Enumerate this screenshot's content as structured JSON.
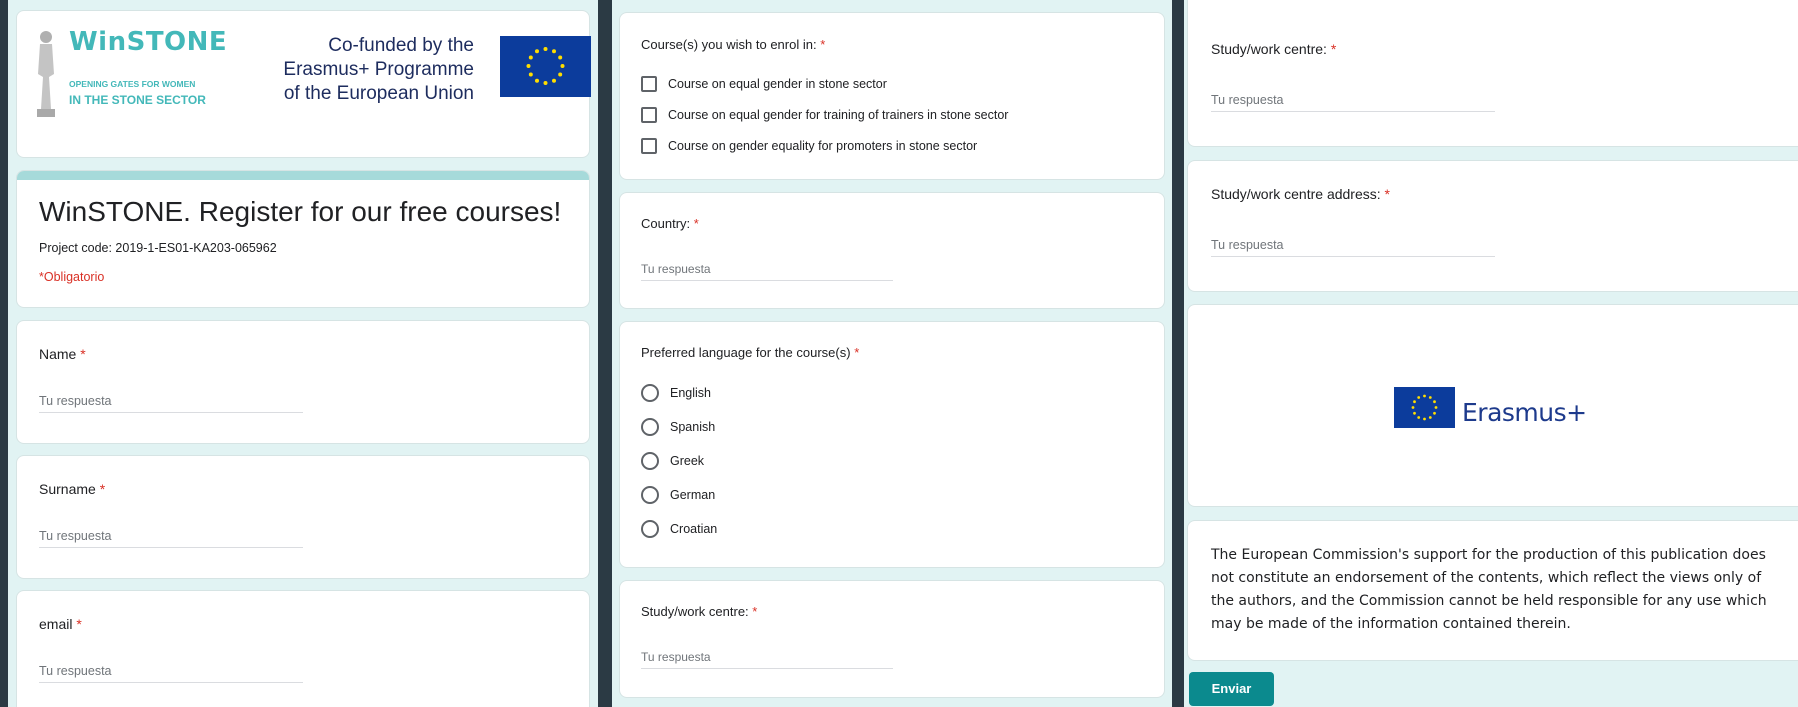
{
  "colors": {
    "accent": "#0b8a8e",
    "required": "#d93025",
    "header_bar": "#a6dada",
    "logo_teal": "#43b8b9",
    "eu_blue": "#0c3c9c",
    "eu_star": "#ffdd00"
  },
  "header": {
    "logo_title": "WinSTONE",
    "logo_tagline_1": "OPENING GATES FOR WOMEN",
    "logo_tagline_2": "IN THE STONE SECTOR",
    "cofunded_1": "Co-funded by the",
    "cofunded_2": "Erasmus+ Programme",
    "cofunded_3": "of the European Union"
  },
  "form": {
    "title": "WinSTONE. Register for our free courses!",
    "project_code": "Project code: 2019-1-ES01-KA203-065962",
    "required_note": "*Obligatorio"
  },
  "required_marker": "*",
  "answer_placeholder": "Tu respuesta",
  "fields": {
    "name": "Name",
    "surname": "Surname",
    "email": "email",
    "courses": "Course(s) you wish to enrol in:",
    "country": "Country:",
    "language": "Preferred language for the course(s)",
    "study_centre": "Study/work centre:",
    "study_centre_address": "Study/work centre address:"
  },
  "courses_options": [
    "Course on equal gender in stone sector",
    "Course on equal gender for training of trainers in stone sector",
    "Course on gender equality for promoters in stone sector"
  ],
  "language_options": [
    "English",
    "Spanish",
    "Greek",
    "German",
    "Croatian"
  ],
  "erasmus_logo_text": "Erasmus+",
  "disclaimer": "The European Commission's support for the production of this publication does not constitute an endorsement of the contents, which reflect the views only of the authors, and the Commission cannot be held responsible for any use which may be made of the information contained therein.",
  "submit_label": "Enviar"
}
